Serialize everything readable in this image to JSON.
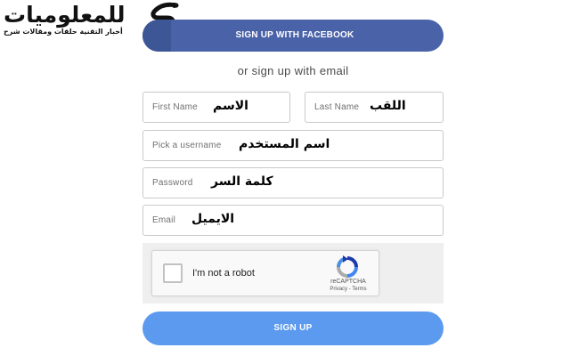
{
  "logo": {
    "title": "للمعلوميات",
    "subtitle": "أخبار التقنية حلقات ومقالات شرح",
    "emblem": "kaf-calligraphy-logo"
  },
  "facebook_button": {
    "label": "SIGN UP WITH FACEBOOK",
    "icon": "facebook-icon",
    "color": "#4a62a8"
  },
  "divider_text": "or sign up with email",
  "form": {
    "first_name": {
      "placeholder": "First Name",
      "annotation": "الاسم"
    },
    "last_name": {
      "placeholder": "Last Name",
      "annotation": "اللقب"
    },
    "username": {
      "placeholder": "Pick a username",
      "annotation": "اسم المستخدم"
    },
    "password": {
      "placeholder": "Password",
      "annotation": "كلمة السر"
    },
    "email": {
      "placeholder": "Email",
      "annotation": "الايميل"
    }
  },
  "captcha": {
    "label": "I'm not a robot",
    "brand": "reCAPTCHA",
    "privacy": "Privacy",
    "separator": " - ",
    "terms": "Terms",
    "icon": "recaptcha-icon",
    "checked": false
  },
  "signup_button": {
    "label": "SIGN UP",
    "color": "#5b9aee"
  }
}
